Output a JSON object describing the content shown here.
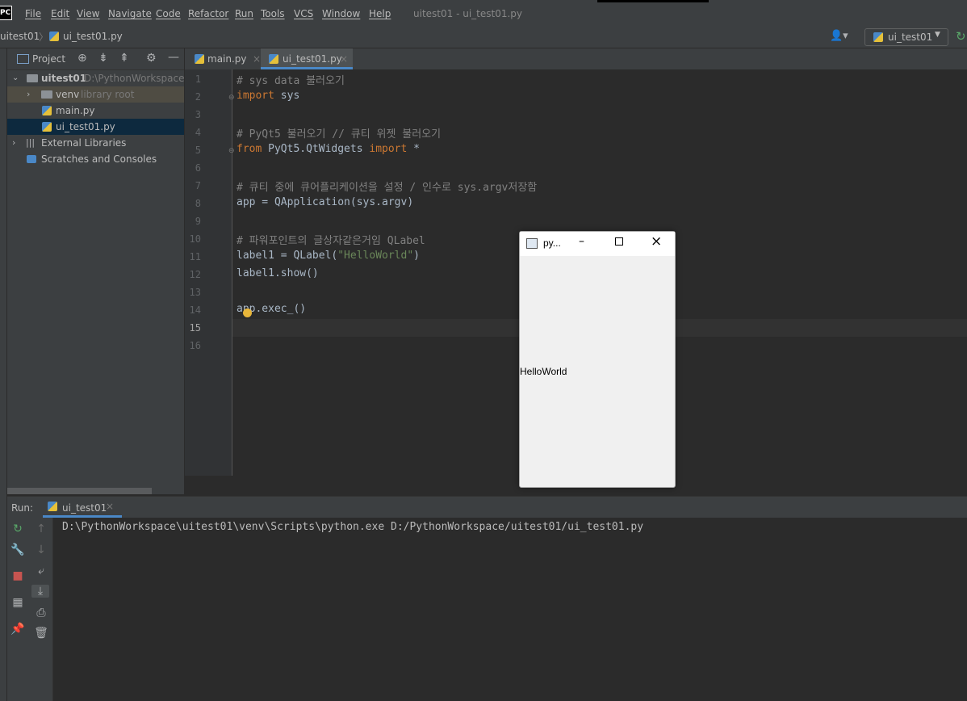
{
  "menubar": {
    "logo": "PC",
    "items": [
      "File",
      "Edit",
      "View",
      "Navigate",
      "Code",
      "Refactor",
      "Run",
      "Tools",
      "VCS",
      "Window",
      "Help"
    ],
    "title": "uitest01 - ui_test01.py"
  },
  "navbar": {
    "project": "uitest01",
    "file": "ui_test01.py",
    "run_config": "ui_test01"
  },
  "project_panel": {
    "title": "Project",
    "tree": [
      {
        "label": "uitest01",
        "hint": "D:\\PythonWorkspace\\"
      },
      {
        "label": "venv",
        "hint": "library root"
      },
      {
        "label": "main.py",
        "hint": ""
      },
      {
        "label": "ui_test01.py",
        "hint": ""
      },
      {
        "label": "External Libraries",
        "hint": ""
      },
      {
        "label": "Scratches and Consoles",
        "hint": ""
      }
    ]
  },
  "tabs": [
    {
      "label": "main.py"
    },
    {
      "label": "ui_test01.py"
    }
  ],
  "editor": {
    "line_numbers": [
      "1",
      "2",
      "3",
      "4",
      "5",
      "6",
      "7",
      "8",
      "9",
      "10",
      "11",
      "12",
      "13",
      "14",
      "15",
      "16"
    ],
    "lines": [
      [
        {
          "t": "# sys data 불러오기",
          "c": "cm"
        }
      ],
      [
        {
          "t": "import",
          "c": "kw"
        },
        {
          "t": " sys",
          "c": ""
        }
      ],
      [],
      [
        {
          "t": "# PyQt5 불러오기 // 큐티 위젯 불러오기",
          "c": "cm"
        }
      ],
      [
        {
          "t": "from",
          "c": "kw"
        },
        {
          "t": " PyQt5.QtWidgets ",
          "c": ""
        },
        {
          "t": "import",
          "c": "kw"
        },
        {
          "t": " *",
          "c": ""
        }
      ],
      [],
      [
        {
          "t": "# 큐티 중에 큐어플리케이션을 설정 / 인수로 sys.argv저장함",
          "c": "cm"
        }
      ],
      [
        {
          "t": "app = QApplication(sys.argv)",
          "c": ""
        }
      ],
      [],
      [
        {
          "t": "# 파워포인트의 글상자같은거임 QLabel",
          "c": "cm"
        }
      ],
      [
        {
          "t": "label1 = QLabel(",
          "c": ""
        },
        {
          "t": "\"HelloWorld\"",
          "c": "str"
        },
        {
          "t": ")",
          "c": ""
        }
      ],
      [
        {
          "t": "label1.show()",
          "c": ""
        }
      ],
      [],
      [
        {
          "t": "app.exec_()",
          "c": ""
        }
      ],
      [],
      []
    ]
  },
  "run_panel": {
    "label": "Run:",
    "tab": "ui_test01",
    "console": "D:\\PythonWorkspace\\uitest01\\venv\\Scripts\\python.exe D:/PythonWorkspace/uitest01/ui_test01.py"
  },
  "qt_window": {
    "title": "py...",
    "label_text": "HelloWorld"
  }
}
